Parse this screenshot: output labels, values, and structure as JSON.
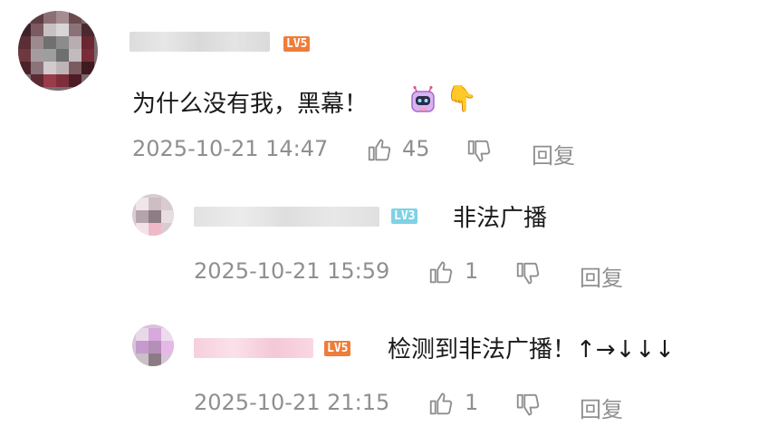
{
  "comment": {
    "user_level": "LV5",
    "text": "为什么没有我，黑幕！",
    "time": "2025-10-21 14:47",
    "likes": "45",
    "reply_label": "回复"
  },
  "replies": [
    {
      "user_level": "LV3",
      "text": "非法广播",
      "time": "2025-10-21 15:59",
      "likes": "1",
      "reply_label": "回复"
    },
    {
      "user_level": "LV5",
      "text": "检测到非法广播！↑→↓↓↓",
      "time": "2025-10-21 21:15",
      "likes": "1",
      "reply_label": "回复"
    }
  ],
  "emoji": {
    "hand": "👇"
  },
  "colors": {
    "level5": "#ef7d3a",
    "level3": "#7fd2e6",
    "meta": "#8f8f8f"
  }
}
